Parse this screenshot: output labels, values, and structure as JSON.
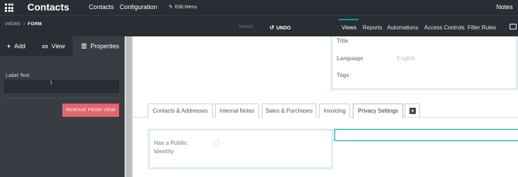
{
  "navbar": {
    "app_title": "Contacts",
    "menu": [
      "Contacts",
      "Configuration"
    ],
    "edit_menu": "Edit Menu",
    "notes": "Notes"
  },
  "subbar": {
    "breadcrumb": [
      "VIEWS",
      "FORM"
    ],
    "saved": "Saved",
    "undo": "UNDO",
    "tabs": [
      "Views",
      "Reports",
      "Automations",
      "Access Controls",
      "Filter Rules"
    ],
    "active_tab": "Views"
  },
  "sidebar": {
    "tabs": {
      "add": "Add",
      "view": "View",
      "properties": "Properties"
    },
    "active_tab": "Properties",
    "label_text": "Label Text",
    "label_value": "",
    "remove_button": "REMOVE FROM VIEW"
  },
  "form": {
    "fields": {
      "title": "Title",
      "language": "Language",
      "language_value": "English",
      "tags": "Tags"
    },
    "tabs": [
      "Contacts & Addresses",
      "Internal Notes",
      "Sales & Purchases",
      "Invoicing",
      "Privacy Settings"
    ],
    "active_tab": "Privacy Settings",
    "privacy": {
      "has_public_identity": "Has a Public Identity",
      "checked": false
    }
  },
  "colors": {
    "navbar_bg": "#2b2d34",
    "sidebar_bg": "#3a3c44",
    "accent": "#00a09d",
    "danger": "#e0656f"
  },
  "icons": [
    "apps-grid-icon",
    "pencil-icon",
    "undo-icon",
    "plus-icon",
    "monitor-icon",
    "sliders-icon",
    "text-cursor-icon",
    "add-tab-icon",
    "device-icon"
  ]
}
